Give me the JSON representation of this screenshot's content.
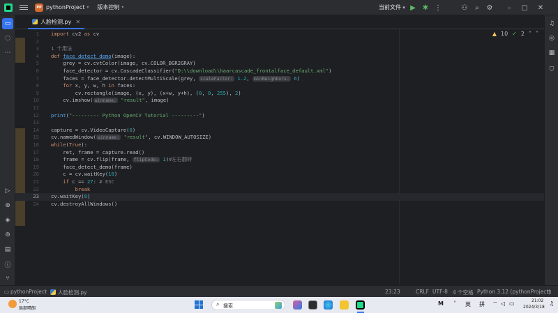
{
  "titlebar": {
    "project_badge": "PP",
    "project_name": "pythonProject",
    "vcs_label": "版本控制",
    "run_config": "当前文件"
  },
  "tab": {
    "label": "人脸检测.py"
  },
  "inspections": {
    "warnings": "10",
    "ok_count": "2"
  },
  "editor": {
    "current_line": 23,
    "lines": [
      {
        "n": "1",
        "html": "<span class=\"kw\">import</span> cv2 <span class=\"kw\">as</span> cv"
      },
      {
        "n": "2",
        "html": ""
      },
      {
        "n": "3",
        "html": "<span class=\"cm\">1 个用法</span>"
      },
      {
        "n": "4",
        "html": "<span class=\"kw\">def</span> <span class=\"fn\">face_detect_demo</span>(image):"
      },
      {
        "n": "5",
        "html": "    grey = cv.cvtColor(image, cv.COLOR_BGR2GRAY)"
      },
      {
        "n": "6",
        "html": "    face_detector = cv.CascadeClassifier(<span class=\"st\">\"D:\\\\download\\\\haarcascade_frontalface_default.xml\"</span>)"
      },
      {
        "n": "7",
        "html": "    faces = face_detector.detectMultiScale(grey, <span class=\"hint\">scaleFactor:</span> <span class=\"nu\">1.2</span>, <span class=\"hint\">minNeighbors:</span> <span class=\"nu\">6</span>)"
      },
      {
        "n": "8",
        "html": "    <span class=\"kw\">for</span> x, y, w, h <span class=\"kw\">in</span> faces:"
      },
      {
        "n": "9",
        "html": "        cv.rectangle(image, (x, y), (x+w, y+h), (<span class=\"nu\">0</span>, <span class=\"nu\">0</span>, <span class=\"nu\">255</span>), <span class=\"nu\">2</span>)"
      },
      {
        "n": "10",
        "html": "    cv.imshow(<span class=\"hint\">winname:</span> <span class=\"st\">\"result\"</span>, image)"
      },
      {
        "n": "11",
        "html": ""
      },
      {
        "n": "12",
        "html": "<span class=\"fnc\">print</span>(<span class=\"st\">\"--------- Python OpenCV Tutorial ---------\"</span>)"
      },
      {
        "n": "13",
        "html": ""
      },
      {
        "n": "14",
        "html": "capture = cv.VideoCapture(<span class=\"nu\">0</span>)"
      },
      {
        "n": "15",
        "html": "cv.namedWindow(<span class=\"hint\">winname:</span> <span class=\"st\">\"result\"</span>, cv.WINDOW_AUTOSIZE)"
      },
      {
        "n": "16",
        "html": "<span class=\"kw\">while</span>(<span class=\"kw\">True</span>):"
      },
      {
        "n": "17",
        "html": "    ret, frame = capture.read()"
      },
      {
        "n": "18",
        "html": "    frame = cv.flip(frame, <span class=\"hint\">flipCode:</span> <span class=\"nu\">1</span>)<span class=\"cm\">#左右翻转</span>"
      },
      {
        "n": "19",
        "html": "    face_detect_demo(frame)"
      },
      {
        "n": "20",
        "html": "    c = cv.waitKey(<span class=\"nu\">10</span>)"
      },
      {
        "n": "21",
        "html": "    <span class=\"kw\">if</span> c == <span class=\"nu\">27</span>: <span class=\"cm\"># ESC</span>"
      },
      {
        "n": "22",
        "html": "        <span class=\"kw\">break</span>"
      },
      {
        "n": "23",
        "html": "cv.waitKey(<span class=\"nu\">0</span>)"
      },
      {
        "n": "24",
        "html": "cv.destroyAllWindows()"
      }
    ],
    "lines_plain": [
      "import cv2 as cv",
      "",
      "1 个用法",
      "def face_detect_demo(image):",
      "    grey = cv.cvtColor(image, cv.COLOR_BGR2GRAY)",
      "    face_detector = cv.CascadeClassifier(\"D:\\\\download\\\\haarcascade_frontalface_default.xml\")",
      "    faces = face_detector.detectMultiScale(grey, scaleFactor: 1.2, minNeighbors: 6)",
      "    for x, y, w, h in faces:",
      "        cv.rectangle(image, (x, y), (x+w, y+h), (0, 0, 255), 2)",
      "    cv.imshow(winname: \"result\", image)",
      "",
      "print(\"--------- Python OpenCV Tutorial ---------\")",
      "",
      "capture = cv.VideoCapture(0)",
      "cv.namedWindow(winname: \"result\", cv.WINDOW_AUTOSIZE)",
      "while(True):",
      "    ret, frame = capture.read()",
      "    frame = cv.flip(frame, flipCode: 1)#左右翻转",
      "    face_detect_demo(frame)",
      "    c = cv.waitKey(10)",
      "    if c == 27: # ESC",
      "        break",
      "cv.waitKey(0)",
      "cv.destroyAllWindows()"
    ]
  },
  "statusbar": {
    "project": "pythonProject",
    "file": "人脸检测.py",
    "position": "23:23",
    "line_sep": "CRLF",
    "encoding": "UTF-8",
    "indent": "4 个空格",
    "interpreter": "Python 3.12 (pythonProject)"
  },
  "taskbar": {
    "weather_temp": "17°C",
    "weather_desc": "局部晴朗",
    "search_placeholder": "搜索",
    "ime_lang": "英",
    "ime_mode": "拼",
    "time": "21:02",
    "date": "2024/3/18"
  },
  "colors": {
    "accent": "#3574f0",
    "run": "#5fb865",
    "warning": "#f2c55c",
    "keyword": "#cf8e6d",
    "string": "#6aab73",
    "number": "#2aacb8",
    "function": "#56a8f5"
  }
}
